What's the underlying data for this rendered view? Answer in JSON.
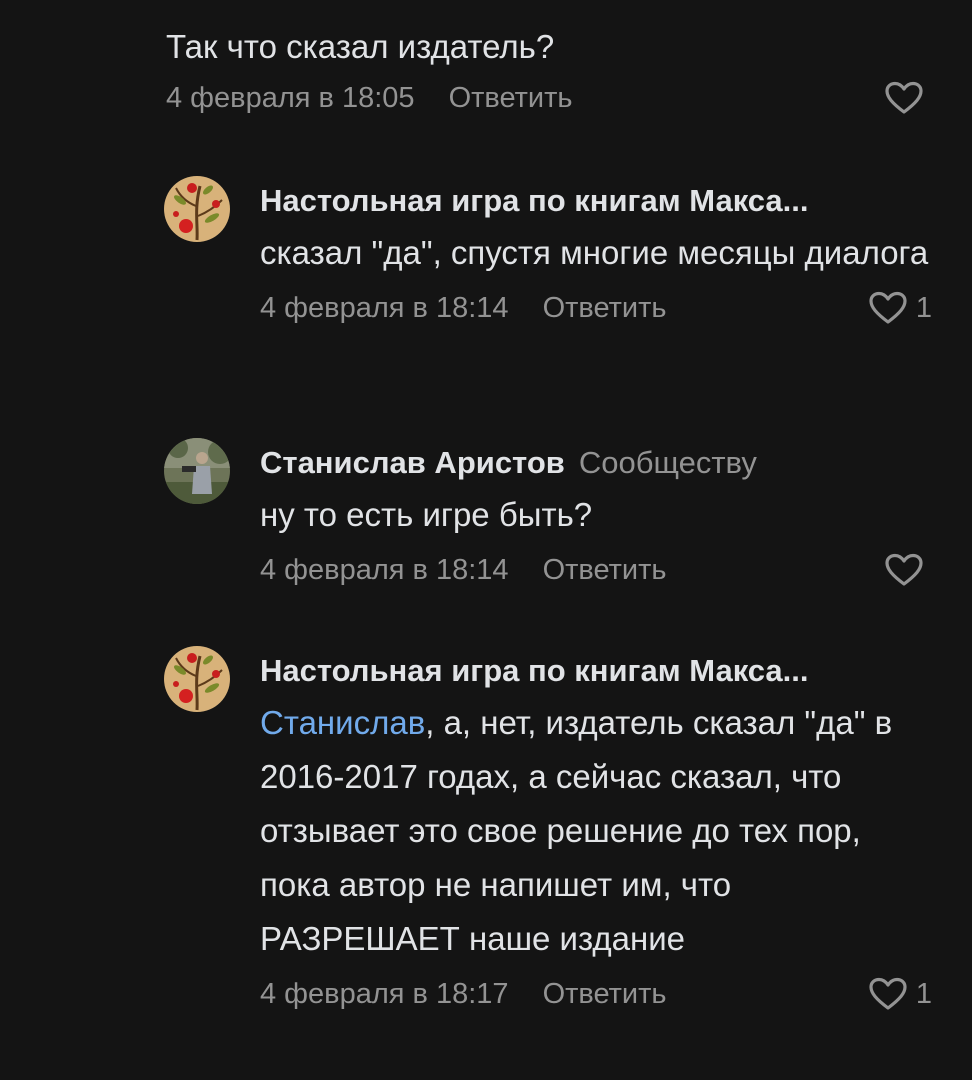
{
  "comments": [
    {
      "author": "",
      "reply_to": "",
      "mention": "",
      "text": "Так что сказал издатель?",
      "date": "4 февраля в 18:05",
      "reply_label": "Ответить",
      "likes": ""
    },
    {
      "author": "Настольная игра по книгам Макса...",
      "reply_to": "",
      "mention": "",
      "text": "сказал \"да\", спустя многие месяцы диалога",
      "date": "4 февраля в 18:14",
      "reply_label": "Ответить",
      "likes": "1"
    },
    {
      "author": "Станислав Аристов",
      "reply_to": "Сообществу",
      "mention": "",
      "text": "ну то есть игре быть?",
      "date": "4 февраля в 18:14",
      "reply_label": "Ответить",
      "likes": ""
    },
    {
      "author": "Настольная игра по книгам Макса...",
      "reply_to": "",
      "mention": "Станислав",
      "text": ", а, нет, издатель сказал \"да\" в 2016-2017 годах, а сейчас сказал, что отзывает это свое решение до тех пор, пока автор не напишет им, что РАЗРЕШАЕТ наше издание",
      "date": "4 февраля в 18:17",
      "reply_label": "Ответить",
      "likes": "1"
    }
  ],
  "icons": {
    "like": "heart-outline-icon",
    "community_avatar": "rowan-branch-avatar",
    "user_avatar": "photo-avatar"
  },
  "colors": {
    "background": "#141414",
    "text": "#e1e3e6",
    "secondary": "#939393",
    "mention": "#71aaeb"
  }
}
